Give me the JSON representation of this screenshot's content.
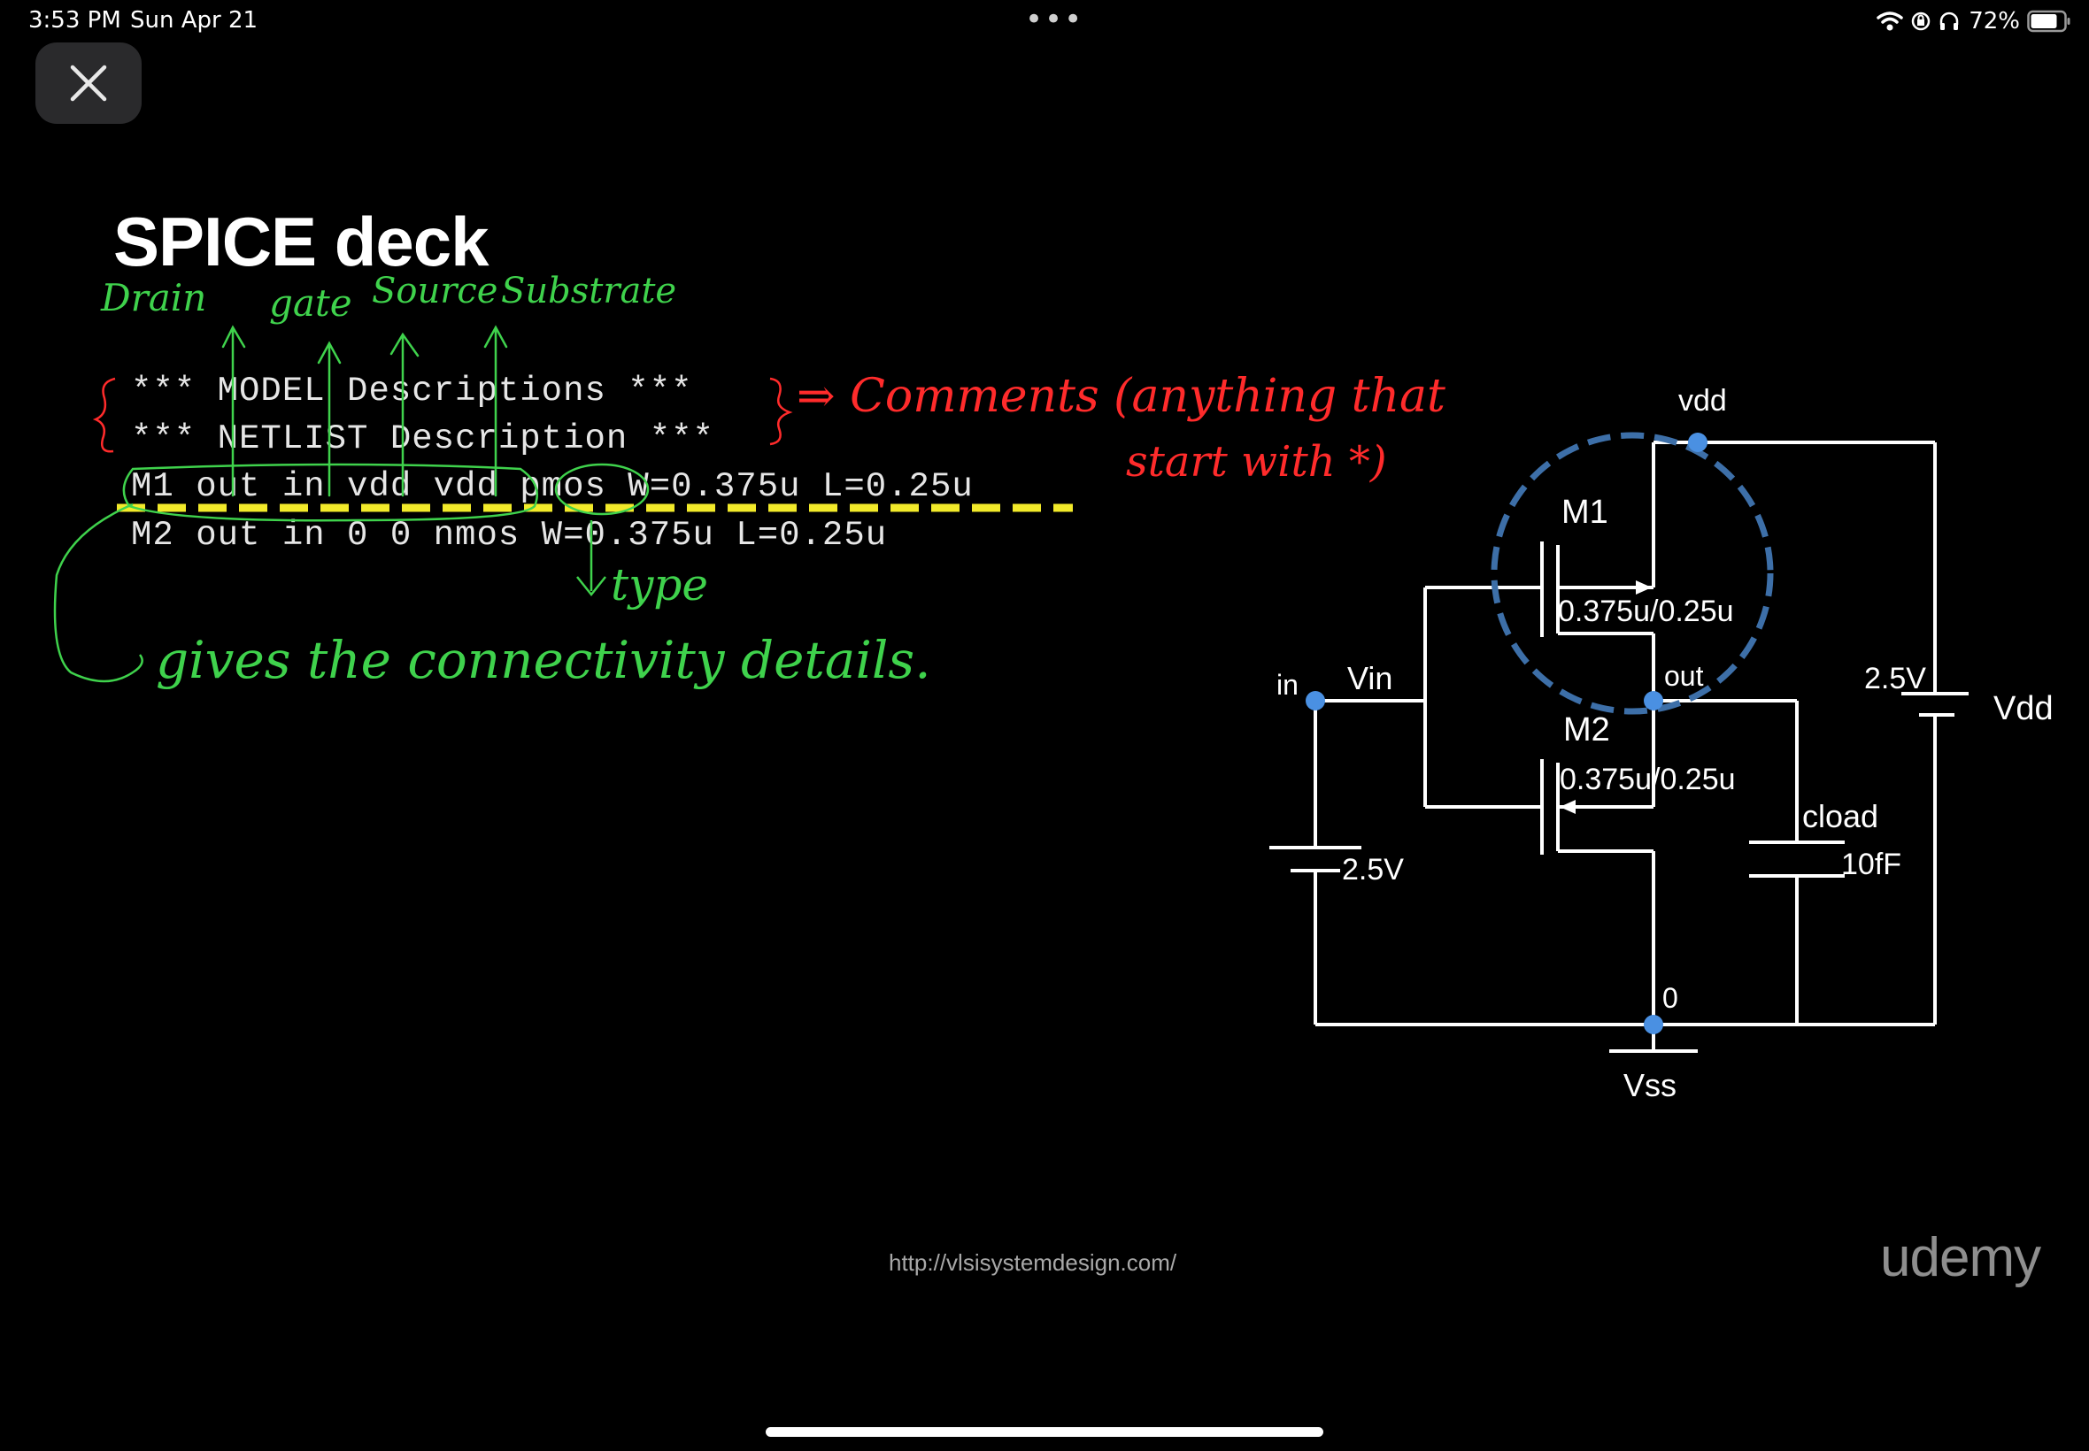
{
  "status_bar": {
    "time": "3:53 PM",
    "date": "Sun Apr 21",
    "dots": "•••",
    "battery": "72%",
    "icons": [
      "wifi-icon",
      "orientation-lock-icon",
      "headphones-icon",
      "battery-icon"
    ]
  },
  "toolbar": {
    "close_icon": "close-icon"
  },
  "slide": {
    "title": "SPICE deck",
    "code_lines": [
      "*** MODEL Descriptions ***",
      "*** NETLIST Description ***",
      "M1 out in vdd vdd pmos W=0.375u L=0.25u",
      "M2 out in 0 0 nmos W=0.375u L=0.25u"
    ],
    "annotations": {
      "drain": "Drain",
      "gate": "gate",
      "source": "Source",
      "substrate": "Substrate",
      "comments_line1": "⇒ Comments (anything that",
      "comments_line2": "start with *)",
      "type": "type",
      "connectivity": "gives the connectivity details."
    },
    "colors": {
      "handwriting_green": "#3fd24c",
      "handwriting_red": "#ff2b2b",
      "highlight_yellow": "#f2ea2a",
      "circle_blue": "#3d6fa8",
      "node_blue": "#4a90e2"
    }
  },
  "circuit": {
    "vdd_node": "vdd",
    "m1": "M1",
    "m1_size": "0.375u/0.25u",
    "m2": "M2",
    "m2_size": "0.375u/0.25u",
    "in_node": "in",
    "vin": "Vin",
    "out_node": "out",
    "vdd_source_value": "2.5V",
    "vdd_source_name": "Vdd",
    "vin_source_value": "2.5V",
    "cload_name": "cload",
    "cload_value": "10fF",
    "ground_node": "0",
    "vss": "Vss"
  },
  "footer": {
    "url": "http://vlsisystemdesign.com/",
    "logo": "udemy"
  }
}
